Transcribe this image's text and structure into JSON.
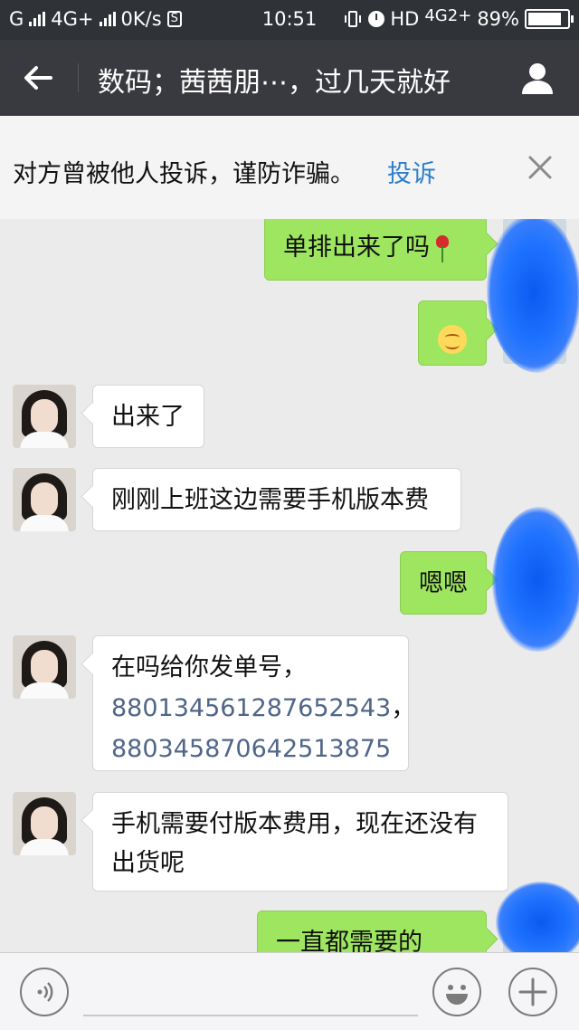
{
  "status_bar": {
    "carrier": "G",
    "network": "4G+",
    "speed": "0K/s",
    "s_badge": "S",
    "time": "10:51",
    "hd": "HD",
    "network2": "4G",
    "network2_sup": "2+",
    "battery": "89%",
    "battery_level": 0.89
  },
  "header": {
    "back_icon": "back-arrow-icon",
    "title": "数码；茜茜朋⋯，过几天就好",
    "profile_icon": "person-icon"
  },
  "warning": {
    "text": "对方曾被他人投诉，谨防诈骗。",
    "link": "投诉",
    "close_icon": "close-icon"
  },
  "messages": [
    {
      "side": "out",
      "text": "单排出来了吗",
      "emoji": "rose-icon"
    },
    {
      "side": "out",
      "emoji": "smile-emoji-icon"
    },
    {
      "side": "in",
      "text": "出来了"
    },
    {
      "side": "in",
      "text": "刚刚上班这边需要手机版本费"
    },
    {
      "side": "out",
      "text": "嗯嗯"
    },
    {
      "side": "in",
      "line1": "在吗给你发单号，",
      "num1": "8801345612876525​43",
      "num1_clean": "880134561287652543",
      "num1_suffix": "，",
      "num2": "880345870642513875"
    },
    {
      "side": "in",
      "line1": "手机需要付版本费用，现在还没有",
      "line2": "出货呢"
    },
    {
      "side": "out",
      "text": "一直都需要的吗？"
    }
  ],
  "input_bar": {
    "voice_icon": "voice-icon",
    "emoji_icon": "emoji-icon",
    "plus_icon": "plus-icon"
  }
}
